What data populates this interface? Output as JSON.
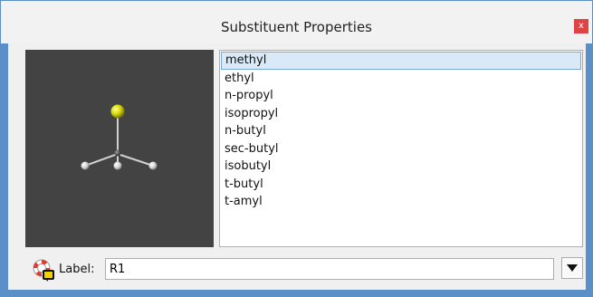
{
  "window": {
    "title": "Substituent Properties",
    "close_label": "x"
  },
  "substituents": {
    "selected_index": 0,
    "items": [
      "methyl",
      "ethyl",
      "n-propyl",
      "isopropyl",
      "n-butyl",
      "sec-butyl",
      "isobutyl",
      "t-butyl",
      "t-amyl"
    ]
  },
  "label_field": {
    "label": "Label:",
    "value": "R1"
  },
  "colors": {
    "title_bar": "#f2f2f2",
    "frame": "#5b8fc7",
    "viewer_bg": "#434343",
    "attach_atom": "#d8d800",
    "carbon": "#555555",
    "hydrogen": "#e6e6e6",
    "selection": "#d9e9f8"
  },
  "icons": {
    "help": "lifebuoy-icon",
    "dropdown": "triangle-down-icon"
  }
}
